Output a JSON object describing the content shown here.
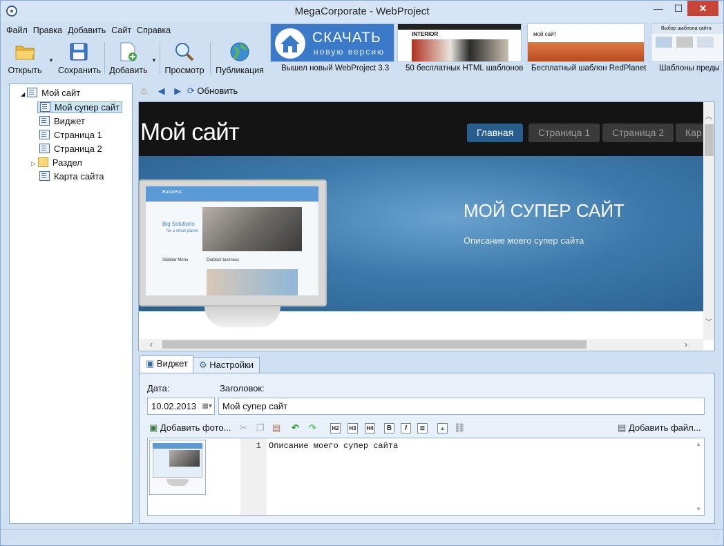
{
  "window": {
    "title": "MegaCorporate - WebProject",
    "minimize": "—",
    "maximize": "☐",
    "close": "✕"
  },
  "menu": [
    "Файл",
    "Правка",
    "Добавить",
    "Сайт",
    "Справка"
  ],
  "toolbar": {
    "open": "Открыть",
    "save": "Сохранить",
    "add": "Добавить",
    "preview": "Просмотр",
    "publish": "Публикация"
  },
  "news": [
    {
      "caption": "Вышел новый WebProject 3.3",
      "banner_title": "СКАЧАТЬ",
      "banner_sub": "новую версию"
    },
    {
      "caption": "50 бесплатных HTML шаблонов",
      "banner_title": "INTERIOR"
    },
    {
      "caption": "Бесплатный шаблон RedPlanet",
      "banner_title": "мой сайт"
    },
    {
      "caption": "Шаблоны преды",
      "banner_title": "Выбор шаблона сайта"
    }
  ],
  "tree": {
    "root": "Мой сайт",
    "items": [
      "Мой супер сайт",
      "Виджет",
      "Страница 1",
      "Страница 2",
      "Раздел",
      "Карта сайта"
    ]
  },
  "nav": {
    "refresh": "Обновить"
  },
  "preview": {
    "site_title": "Мой сайт",
    "nav_items": [
      "Главная",
      "Страница 1",
      "Страница 2",
      "Кар"
    ],
    "hero_title": "МОЙ СУПЕР САЙТ",
    "hero_desc": "Описание моего супер сайта",
    "screen_brand": "Business",
    "screen_headline": "Big Solutions",
    "screen_sub": "for a small planet",
    "screen_menu": "Sidebar Menu",
    "screen_outdoor": "Outdoor business"
  },
  "tabs": {
    "widget": "Виджет",
    "settings": "Настройки"
  },
  "editor": {
    "date_label": "Дата:",
    "date_value": "10.02.2013",
    "title_label": "Заголовок:",
    "title_value": "Мой супер сайт",
    "add_photo": "Добавить фото...",
    "add_file": "Добавить файл...",
    "h2": "H2",
    "h3": "H3",
    "h4": "H4",
    "bold": "B",
    "italic": "I",
    "line_number": "1",
    "content": "Описание моего супер сайта"
  },
  "colors": {
    "accent": "#265d8d",
    "hero": "#3c79aa",
    "header": "#141414"
  }
}
